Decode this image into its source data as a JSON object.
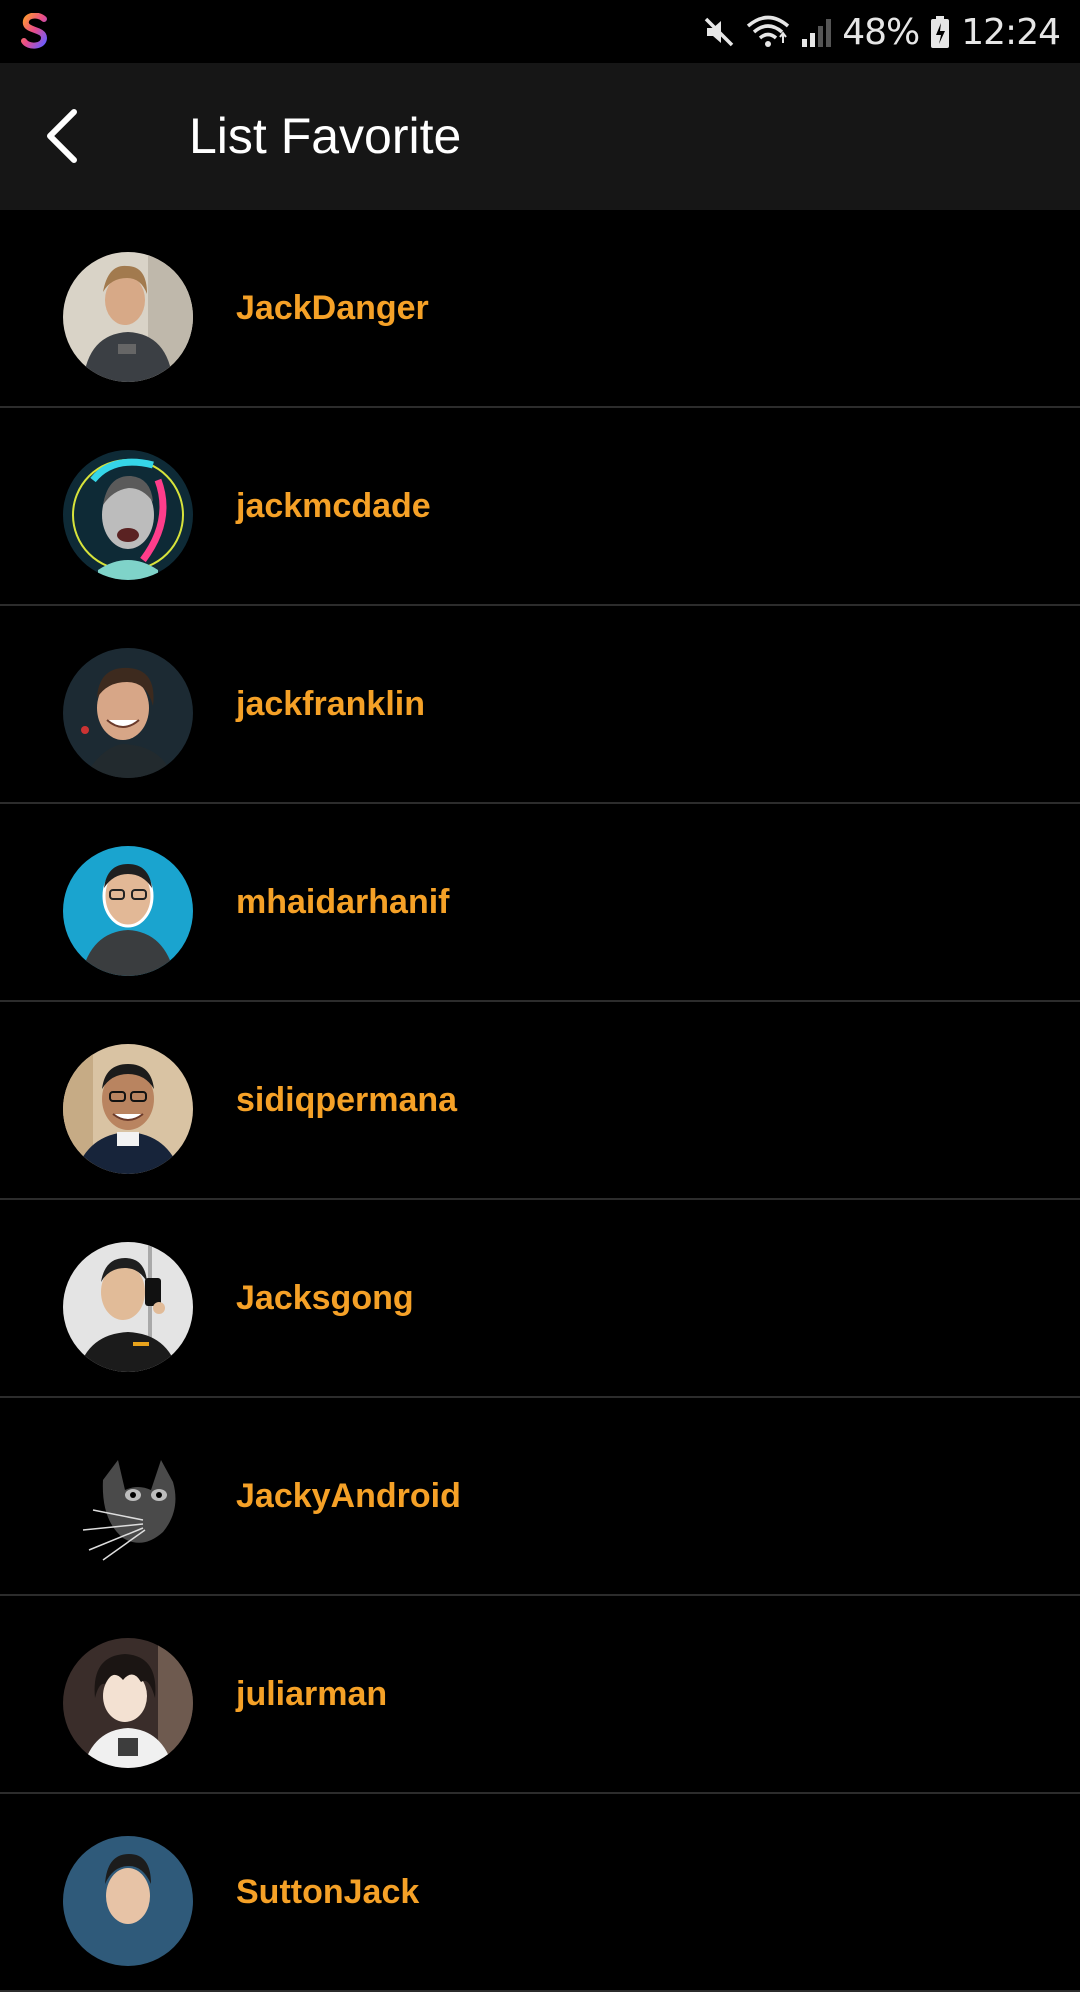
{
  "status_bar": {
    "battery": "48%",
    "time": "12:24",
    "icons": [
      "app-logo-icon",
      "mute-icon",
      "wifi-icon",
      "signal-icon",
      "battery-icon"
    ]
  },
  "app_bar": {
    "title": "List Favorite",
    "back_icon": "chevron-left-icon"
  },
  "colors": {
    "background": "#000000",
    "app_bar": "#161616",
    "username": "#f5a127",
    "divider": "#2c2c2c"
  },
  "favorites": [
    {
      "username": "JackDanger"
    },
    {
      "username": "jackmcdade"
    },
    {
      "username": "jackfranklin"
    },
    {
      "username": "mhaidarhanif"
    },
    {
      "username": "sidiqpermana"
    },
    {
      "username": "Jacksgong"
    },
    {
      "username": "JackyAndroid"
    },
    {
      "username": "juliarman"
    },
    {
      "username": "SuttonJack"
    }
  ]
}
